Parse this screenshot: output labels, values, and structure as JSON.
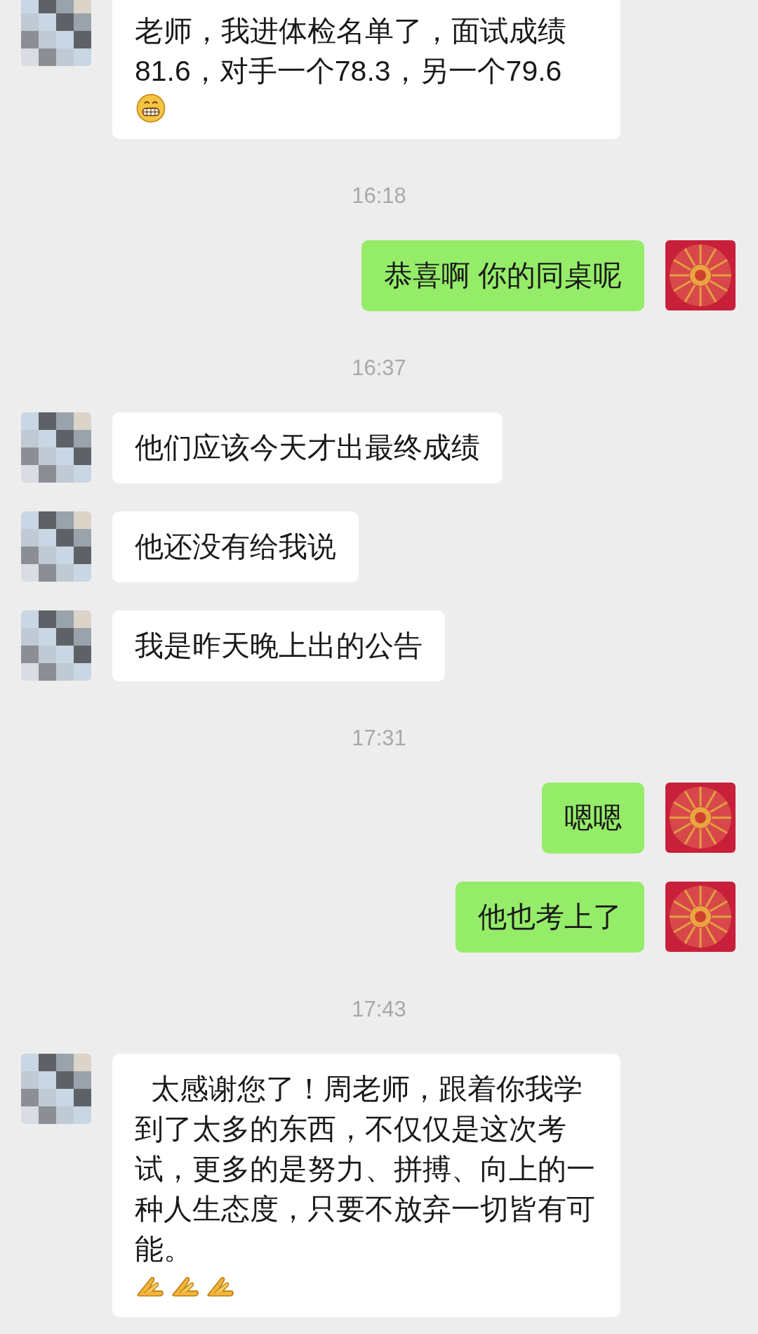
{
  "messages": [
    {
      "kind": "incoming",
      "text": "老师，我进体检名单了，面试成绩81.6，对手一个78.3，另一个79.6",
      "icons": [
        {
          "kind": "grin"
        }
      ]
    },
    {
      "kind": "time",
      "text": "16:18"
    },
    {
      "kind": "outgoing",
      "text": "恭喜啊 你的同桌呢"
    },
    {
      "kind": "time",
      "text": "16:37"
    },
    {
      "kind": "incoming",
      "text": "他们应该今天才出最终成绩"
    },
    {
      "kind": "incoming",
      "text": "他还没有给我说"
    },
    {
      "kind": "incoming",
      "text": "我是昨天晚上出的公告"
    },
    {
      "kind": "time",
      "text": "17:31"
    },
    {
      "kind": "outgoing",
      "text": "嗯嗯"
    },
    {
      "kind": "outgoing",
      "text": "他也考上了"
    },
    {
      "kind": "time",
      "text": "17:43"
    },
    {
      "kind": "incoming",
      "text": "  太感谢您了！周老师，跟着你我学到了太多的东西，不仅仅是这次考试，更多的是努力、拼搏、向上的一种人生态度，只要不放弃一切皆有可能。",
      "icons": [
        {
          "kind": "pray"
        },
        {
          "kind": "pray"
        },
        {
          "kind": "pray"
        }
      ]
    }
  ]
}
